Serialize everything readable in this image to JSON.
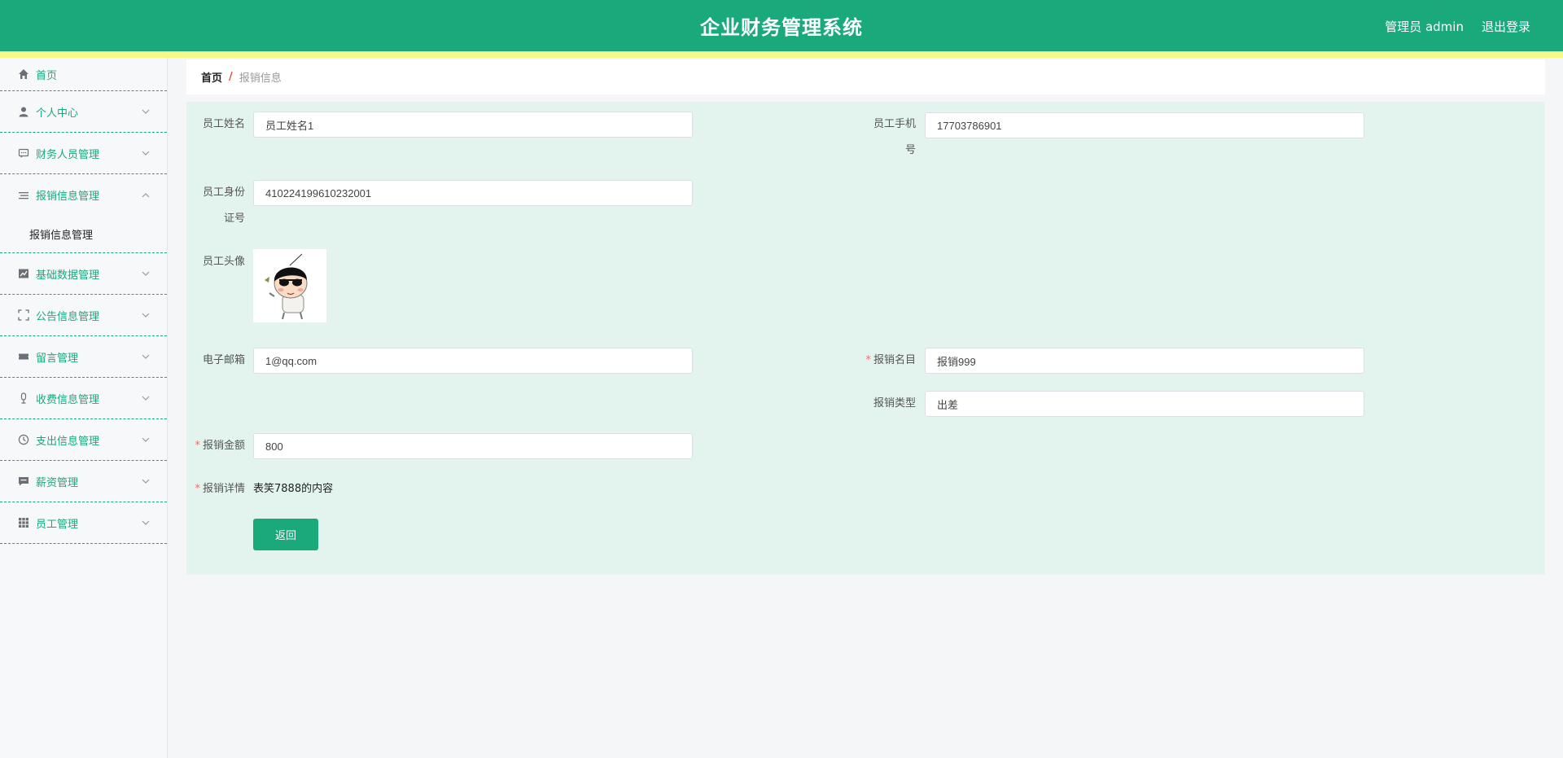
{
  "header": {
    "title": "企业财务管理系统",
    "user_label": "管理员 admin",
    "logout_label": "退出登录"
  },
  "sidebar": {
    "items": [
      {
        "label": "首页",
        "icon": "home-icon"
      },
      {
        "label": "个人中心",
        "icon": "user-icon"
      },
      {
        "label": "财务人员管理",
        "icon": "chat-icon"
      },
      {
        "label": "报销信息管理",
        "icon": "list-icon",
        "expanded": true,
        "children": [
          {
            "label": "报销信息管理"
          }
        ]
      },
      {
        "label": "基础数据管理",
        "icon": "chart-icon"
      },
      {
        "label": "公告信息管理",
        "icon": "fullscreen-icon"
      },
      {
        "label": "留言管理",
        "icon": "ticket-icon"
      },
      {
        "label": "收费信息管理",
        "icon": "microphone-icon"
      },
      {
        "label": "支出信息管理",
        "icon": "clock-icon"
      },
      {
        "label": "薪资管理",
        "icon": "message-icon"
      },
      {
        "label": "员工管理",
        "icon": "grid-icon"
      }
    ]
  },
  "breadcrumb": {
    "home": "首页",
    "separator": "/",
    "current": "报销信息"
  },
  "form": {
    "employee_name": {
      "label": "员工姓名",
      "value": "员工姓名1"
    },
    "employee_phone": {
      "label_line1": "员工手机",
      "label_line2": "号",
      "value": "17703786901"
    },
    "employee_id": {
      "label_line1": "员工身份",
      "label_line2": "证号",
      "value": "410224199610232001"
    },
    "employee_avatar": {
      "label": "员工头像"
    },
    "email": {
      "label": "电子邮箱",
      "value": "1@qq.com"
    },
    "expense_name": {
      "label": "报销名目",
      "value": "报销999",
      "required": true
    },
    "expense_type": {
      "label": "报销类型",
      "value": "出差"
    },
    "expense_amount": {
      "label": "报销金额",
      "value": "800",
      "required": true
    },
    "expense_detail": {
      "label": "报销详情",
      "value": "表笑7888的内容",
      "required": true
    },
    "back_label": "返回"
  },
  "colors": {
    "primary": "#1aa97b",
    "stripe": "#f6f88a",
    "panel": "#e3f4ef",
    "required": "#f56c6c",
    "breadcrumb_separator": "#e0542f"
  }
}
